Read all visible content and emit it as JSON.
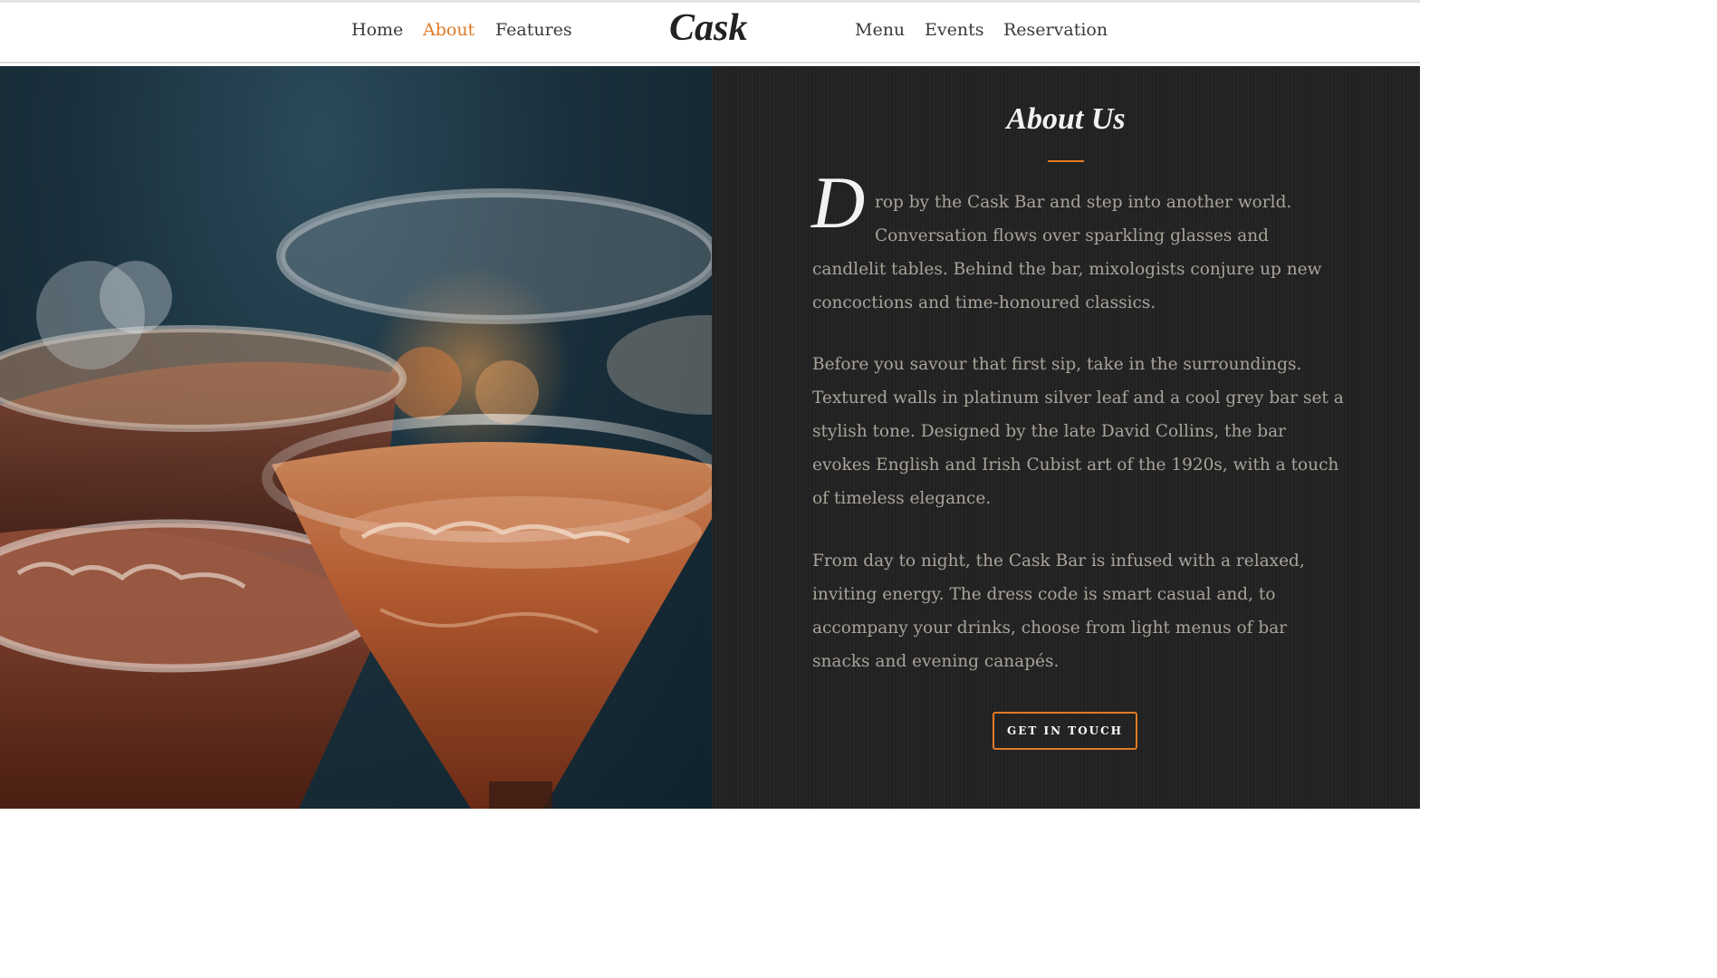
{
  "nav": {
    "left": [
      {
        "label": "Home"
      },
      {
        "label": "About",
        "active": true
      },
      {
        "label": "Features"
      }
    ],
    "logo": "Cask",
    "right": [
      {
        "label": "Menu"
      },
      {
        "label": "Events"
      },
      {
        "label": "Reservation"
      }
    ]
  },
  "about": {
    "title": "About Us",
    "drop_cap": "D",
    "para1_lines": [
      "rop by the Cask Bar and step into another world.",
      "Conversation flows over sparkling glasses and",
      "candlelit tables. Behind the bar, mixologists conjure up new",
      "concoctions and time-honoured classics."
    ],
    "para2_lines": [
      "Before you savour that first sip, take in the surroundings.",
      "Textured walls in platinum silver leaf and a cool grey bar set a",
      "stylish tone. Designed by the late David Collins, the bar",
      "evokes English and Irish Cubist art of the 1920s, with a touch",
      "of timeless elegance."
    ],
    "para3_lines": [
      "From day to night, the Cask Bar is infused with a relaxed,",
      "inviting energy. The dress code is smart casual and, to",
      "accompany your drinks, choose from light menus of bar",
      "snacks and evening canapés."
    ],
    "cta_label": "GET IN TOUCH"
  },
  "colors": {
    "accent": "#e07a26",
    "panel_bg": "#222222",
    "body_text": "#a9a39b",
    "nav_text": "#3a3a3a"
  },
  "hero_image": {
    "subject": "cocktail-glasses-photo"
  }
}
